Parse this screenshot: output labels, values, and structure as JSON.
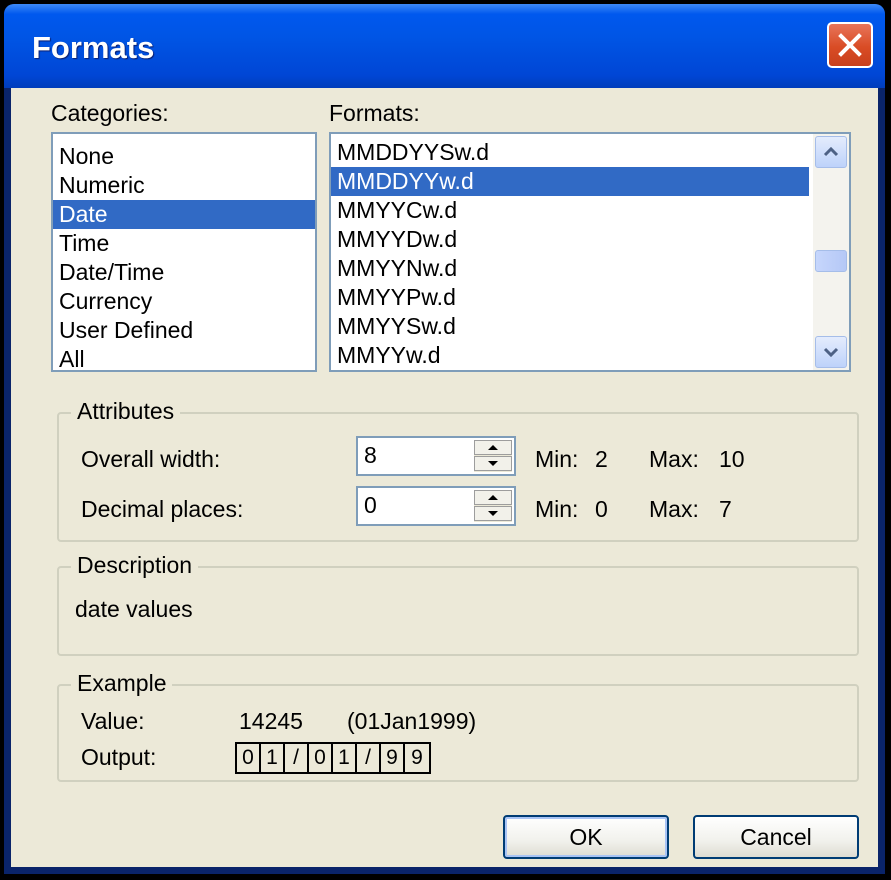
{
  "window": {
    "title": "Formats"
  },
  "categories": {
    "label": "Categories:",
    "items": [
      "None",
      "Numeric",
      "Date",
      "Time",
      "Date/Time",
      "Currency",
      "User Defined",
      "All"
    ],
    "selected_index": 2
  },
  "formats": {
    "label": "Formats:",
    "items": [
      "MMDDYYSw.d",
      "MMDDYYw.d",
      "MMYYCw.d",
      "MMYYDw.d",
      "MMYYNw.d",
      "MMYYPw.d",
      "MMYYSw.d",
      "MMYYw.d"
    ],
    "selected_index": 1
  },
  "attributes": {
    "title": "Attributes",
    "overall_width": {
      "label": "Overall width:",
      "value": "8",
      "min_label": "Min:",
      "min": "2",
      "max_label": "Max:",
      "max": "10"
    },
    "decimal_places": {
      "label": "Decimal places:",
      "value": "0",
      "min_label": "Min:",
      "min": "0",
      "max_label": "Max:",
      "max": "7"
    }
  },
  "description": {
    "title": "Description",
    "text": "date values"
  },
  "example": {
    "title": "Example",
    "value_label": "Value:",
    "value": "14245",
    "value_date": "(01Jan1999)",
    "output_label": "Output:",
    "output_chars": [
      "0",
      "1",
      "/",
      "0",
      "1",
      "/",
      "9",
      "9"
    ]
  },
  "buttons": {
    "ok": "OK",
    "cancel": "Cancel"
  },
  "colors": {
    "selection": "#316ac5",
    "titlebar": "#0055e5",
    "close": "#d94c25",
    "dialog_bg": "#ece9d8"
  }
}
